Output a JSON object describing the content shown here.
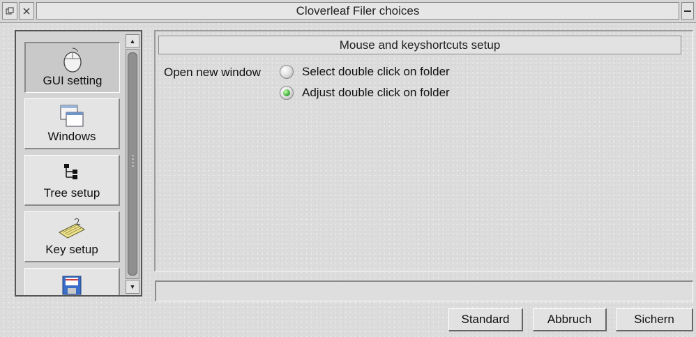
{
  "window": {
    "title": "Cloverleaf Filer choices"
  },
  "sidebar": {
    "items": [
      {
        "label": "GUI setting",
        "icon": "mouse-icon",
        "active": true
      },
      {
        "label": "Windows",
        "icon": "windows-icon",
        "active": false
      },
      {
        "label": "Tree setup",
        "icon": "tree-icon",
        "active": false
      },
      {
        "label": "Key setup",
        "icon": "keyboard-icon",
        "active": false
      },
      {
        "label": "",
        "icon": "floppy-disk-icon",
        "active": false
      }
    ]
  },
  "main": {
    "section_title": "Mouse and keyshortcuts setup",
    "option_label": "Open new window",
    "options": [
      {
        "label": "Select double click on folder",
        "selected": false
      },
      {
        "label": "Adjust double click on folder",
        "selected": true
      }
    ]
  },
  "status": {
    "text": ""
  },
  "buttons": {
    "standard": "Standard",
    "cancel": "Abbruch",
    "save": "Sichern"
  },
  "colors": {
    "window_bg": "#dcdcdc",
    "radio_selected": "#3fb03a"
  }
}
